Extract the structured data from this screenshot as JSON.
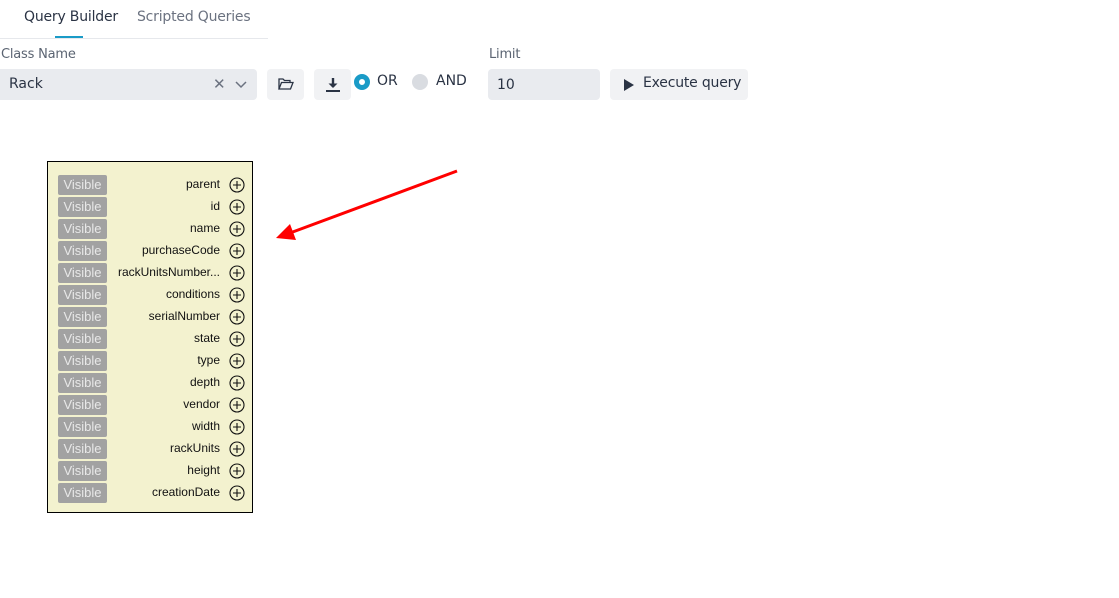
{
  "tabs": [
    {
      "label": "Query Builder",
      "active": true
    },
    {
      "label": "Scripted Queries",
      "active": false
    }
  ],
  "accent_color": "#1a9bc7",
  "class_name": {
    "label": "Class Name",
    "value": "Rack"
  },
  "logic": {
    "options": [
      "OR",
      "AND"
    ],
    "selected": "OR"
  },
  "limit": {
    "label": "Limit",
    "value": "10"
  },
  "execute_label": "Execute query",
  "node": {
    "visible_label": "Visible",
    "attributes": [
      "parent",
      "id",
      "name",
      "purchaseCode",
      "rackUnitsNumber...",
      "conditions",
      "serialNumber",
      "state",
      "type",
      "depth",
      "vendor",
      "width",
      "rackUnits",
      "height",
      "creationDate"
    ]
  },
  "annotation": {
    "type": "arrow",
    "color": "#ff0000"
  }
}
